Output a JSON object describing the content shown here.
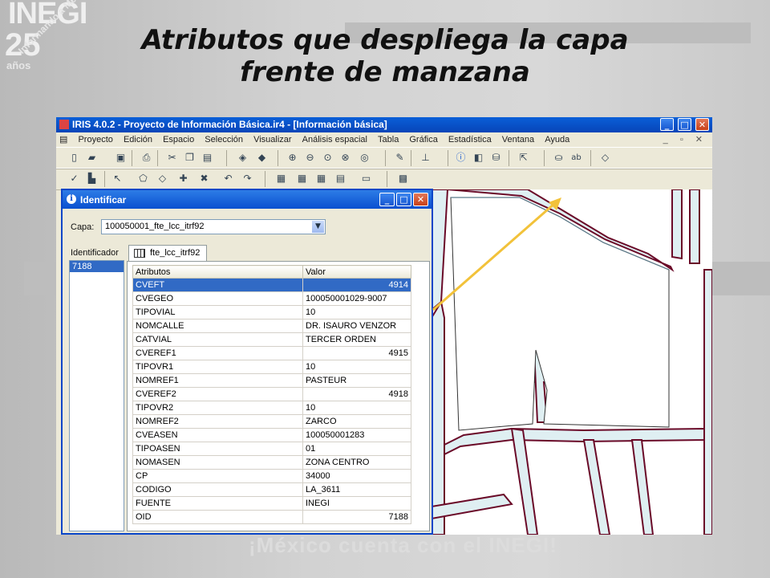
{
  "slide": {
    "title_line1": "Atributos que despliega la capa",
    "title_line2": "frente de manzana",
    "logo_name": "INEGI",
    "logo_years": "25",
    "logo_anos": "años",
    "logo_motto": "Informando a México",
    "footer_slogan": "¡México cuenta con el INEGI!",
    "arrow_color": "#f2c23a"
  },
  "app": {
    "title": "IRIS 4.0.2 - Proyecto de Información Básica.ir4 - [Información básica]",
    "menu": [
      "Proyecto",
      "Edición",
      "Espacio",
      "Selección",
      "Visualizar",
      "Análisis espacial",
      "Tabla",
      "Gráfica",
      "Estadística",
      "Ventana",
      "Ayuda"
    ],
    "toolbar1_icons": [
      "new-icon",
      "open-icon",
      "save-icon",
      "print-icon",
      "cut-icon",
      "copy-icon",
      "paste-icon",
      "layers-icon",
      "zoom-in-icon",
      "zoom-out-icon",
      "zoom-window-icon",
      "zoom-extent-icon",
      "zoom-select-icon",
      "pencil-icon",
      "measure-icon",
      "info-icon",
      "identify-icon",
      "query-icon",
      "select-icon",
      "fill-icon",
      "label-icon",
      "symbol-icon"
    ],
    "toolbar2_icons": [
      "edit-icon",
      "node-icon",
      "vertex-icon",
      "polygon-icon",
      "shape-icon",
      "add-icon",
      "delete-icon",
      "undo-icon",
      "redo-icon",
      "sql-icon",
      "table-icon",
      "join-icon",
      "relate-icon",
      "report-icon",
      "chart-icon"
    ]
  },
  "dialog": {
    "title": "Identificar",
    "capa_label": "Capa:",
    "capa_value": "100050001_fte_lcc_itrf92",
    "identificador_label": "Identificador",
    "identificadores": [
      "7188"
    ],
    "tab_label": "fte_lcc_itrf92",
    "columns": [
      "Atributos",
      "Valor"
    ],
    "rows": [
      {
        "attr": "CVEFT",
        "value": "4914",
        "num": true,
        "selected": true
      },
      {
        "attr": "CVEGEO",
        "value": "100050001029-9007",
        "num": false
      },
      {
        "attr": "TIPOVIAL",
        "value": "10",
        "num": false
      },
      {
        "attr": "NOMCALLE",
        "value": "DR. ISAURO VENZOR",
        "num": false
      },
      {
        "attr": "CATVIAL",
        "value": "TERCER ORDEN",
        "num": false
      },
      {
        "attr": "CVEREF1",
        "value": "4915",
        "num": true
      },
      {
        "attr": "TIPOVR1",
        "value": "10",
        "num": false
      },
      {
        "attr": "NOMREF1",
        "value": "PASTEUR",
        "num": false
      },
      {
        "attr": "CVEREF2",
        "value": "4918",
        "num": true
      },
      {
        "attr": "TIPOVR2",
        "value": "10",
        "num": false
      },
      {
        "attr": "NOMREF2",
        "value": "ZARCO",
        "num": false
      },
      {
        "attr": "CVEASEN",
        "value": "100050001283",
        "num": false
      },
      {
        "attr": "TIPOASEN",
        "value": "01",
        "num": false
      },
      {
        "attr": "NOMASEN",
        "value": "ZONA CENTRO",
        "num": false
      },
      {
        "attr": "CP",
        "value": "34000",
        "num": false
      },
      {
        "attr": "CODIGO",
        "value": "LA_3611",
        "num": false
      },
      {
        "attr": "FUENTE",
        "value": "INEGI",
        "num": false
      },
      {
        "attr": "OID",
        "value": "7188",
        "num": true
      }
    ]
  }
}
